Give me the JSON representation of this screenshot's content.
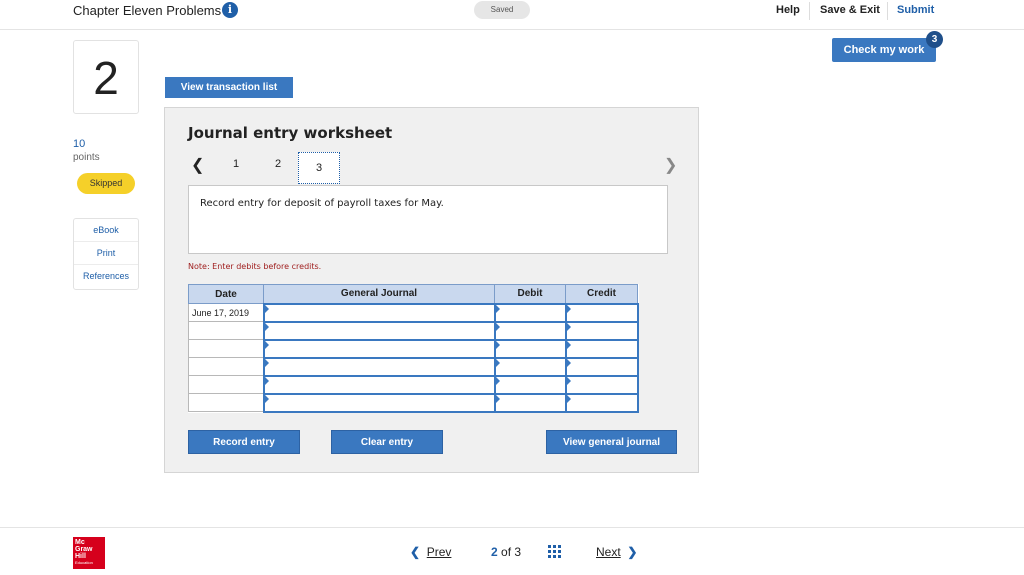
{
  "header": {
    "title": "Chapter Eleven Problems",
    "info_icon": "i",
    "saved": "Saved",
    "help": "Help",
    "save_exit": "Save & Exit",
    "submit": "Submit"
  },
  "question": {
    "number": "2",
    "points_value": "10",
    "points_label": "points",
    "status": "Skipped",
    "tools": [
      "eBook",
      "Print",
      "References"
    ]
  },
  "check_work": {
    "label": "Check my work",
    "badge": "3"
  },
  "view_transaction_list": "View transaction list",
  "worksheet": {
    "title": "Journal entry worksheet",
    "pages": [
      "1",
      "2",
      "3"
    ],
    "active_page": "3",
    "instruction": "Record entry for deposit of payroll taxes for May.",
    "note": "Note: Enter debits before credits.",
    "columns": [
      "Date",
      "General Journal",
      "Debit",
      "Credit"
    ],
    "rows": [
      {
        "date": "June 17, 2019",
        "account": "",
        "debit": "",
        "credit": ""
      },
      {
        "date": "",
        "account": "",
        "debit": "",
        "credit": ""
      },
      {
        "date": "",
        "account": "",
        "debit": "",
        "credit": ""
      },
      {
        "date": "",
        "account": "",
        "debit": "",
        "credit": ""
      },
      {
        "date": "",
        "account": "",
        "debit": "",
        "credit": ""
      },
      {
        "date": "",
        "account": "",
        "debit": "",
        "credit": ""
      }
    ],
    "buttons": {
      "record": "Record entry",
      "clear": "Clear entry",
      "view_journal": "View general journal"
    }
  },
  "footer": {
    "logo_lines": [
      "Mc",
      "Graw",
      "Hill",
      "Education"
    ],
    "prev": "Prev",
    "current": "2",
    "of_label": "of",
    "total": "3",
    "next": "Next"
  }
}
